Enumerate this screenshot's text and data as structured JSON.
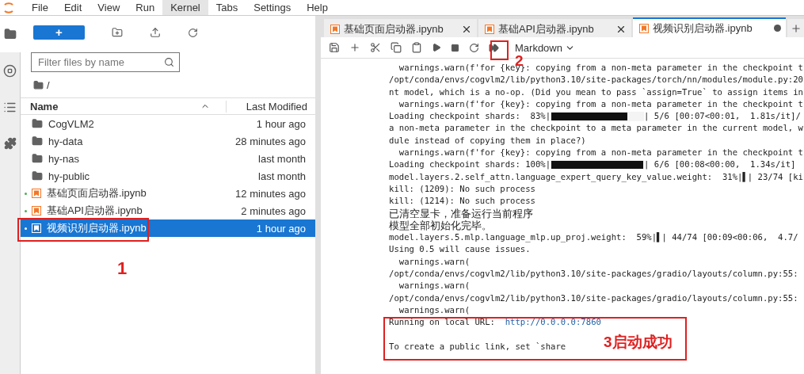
{
  "menu": [
    {
      "label": "File",
      "selected": false
    },
    {
      "label": "Edit",
      "selected": false
    },
    {
      "label": "View",
      "selected": false
    },
    {
      "label": "Run",
      "selected": false
    },
    {
      "label": "Kernel",
      "selected": true
    },
    {
      "label": "Tabs",
      "selected": false
    },
    {
      "label": "Settings",
      "selected": false
    },
    {
      "label": "Help",
      "selected": false
    }
  ],
  "sidebar": {
    "items": [
      {
        "kind": "folder",
        "selected": true
      },
      {
        "kind": "running",
        "selected": false
      },
      {
        "kind": "toc",
        "selected": false
      },
      {
        "kind": "extensions",
        "selected": false
      }
    ]
  },
  "file_browser": {
    "new_button": "+",
    "filter": {
      "placeholder": "Filter files by name"
    },
    "path": "/",
    "columns": [
      "Name",
      "Last Modified"
    ],
    "rows": [
      {
        "kind": "folder",
        "name": "CogVLM2",
        "modified": "1 hour ago",
        "running": false,
        "selected": false
      },
      {
        "kind": "folder",
        "name": "hy-data",
        "modified": "28 minutes ago",
        "running": false,
        "selected": false
      },
      {
        "kind": "folder",
        "name": "hy-nas",
        "modified": "last month",
        "running": false,
        "selected": false
      },
      {
        "kind": "folder",
        "name": "hy-public",
        "modified": "last month",
        "running": false,
        "selected": false
      },
      {
        "kind": "notebook",
        "name": "基础页面启动器.ipynb",
        "modified": "12 minutes ago",
        "running": true,
        "selected": false
      },
      {
        "kind": "notebook",
        "name": "基础API启动器.ipynb",
        "modified": "2 minutes ago",
        "running": true,
        "selected": false
      },
      {
        "kind": "notebook",
        "name": "视频识别启动器.ipynb",
        "modified": "1 hour ago",
        "running": true,
        "selected": true
      }
    ]
  },
  "tabs": [
    {
      "label": "基础页面启动器.ipynb",
      "selected": false,
      "dirty": false
    },
    {
      "label": "基础API启动器.ipynb",
      "selected": false,
      "dirty": false
    },
    {
      "label": "视频识别启动器.ipynb",
      "selected": true,
      "dirty": true
    }
  ],
  "cell_type": "Markdown",
  "output": [
    {
      "kind": "text",
      "text": "  warnings.warn(f'for {key}: copying from a non-meta parameter in the checkpoint t"
    },
    {
      "kind": "text",
      "text": "/opt/conda/envs/cogvlm2/lib/python3.10/site-packages/torch/nn/modules/module.py:20"
    },
    {
      "kind": "text",
      "text": "nt model, which is a no-op. (Did you mean to pass `assign=True` to assign items in"
    },
    {
      "kind": "text",
      "text": "  warnings.warn(f'for {key}: copying from a non-meta parameter in the checkpoint t"
    },
    {
      "kind": "progress",
      "prefix": "Loading checkpoint shards:  83%|",
      "level": 0.83,
      "suffix": "| 5/6 [00:07<00:01,  1.81s/it]/"
    },
    {
      "kind": "text",
      "text": "a non-meta parameter in the checkpoint to a meta parameter in the current model, w"
    },
    {
      "kind": "text",
      "text": "dule instead of copying them in place?)"
    },
    {
      "kind": "text",
      "text": "  warnings.warn(f'for {key}: copying from a non-meta parameter in the checkpoint t"
    },
    {
      "kind": "progress",
      "prefix": "Loading checkpoint shards: 100%|",
      "level": 1,
      "suffix": "| 6/6 [00:08<00:00,  1.34s/it]"
    },
    {
      "kind": "text",
      "text": "model.layers.2.self_attn.language_expert_query_key_value.weight:  31%|▌| 23/74 [ki"
    },
    {
      "kind": "text",
      "text": "kill: (1209): No such process"
    },
    {
      "kind": "text",
      "text": "kill: (1214): No such process"
    },
    {
      "kind": "zh",
      "text": "已清空显卡，准备运行当前程序"
    },
    {
      "kind": "zh",
      "text": "模型全部初始化完毕。"
    },
    {
      "kind": "text",
      "text": "model.layers.5.mlp.language_mlp.up_proj.weight:  59%|▌| 44/74 [00:09<00:06,  4.7/"
    },
    {
      "kind": "text",
      "text": "Using 0.5 will cause issues."
    },
    {
      "kind": "text",
      "text": "  warnings.warn("
    },
    {
      "kind": "text",
      "text": "/opt/conda/envs/cogvlm2/lib/python3.10/site-packages/gradio/layouts/column.py:55:"
    },
    {
      "kind": "text",
      "text": "  warnings.warn("
    },
    {
      "kind": "text",
      "text": "/opt/conda/envs/cogvlm2/lib/python3.10/site-packages/gradio/layouts/column.py:55:"
    },
    {
      "kind": "text",
      "text": "  warnings.warn("
    },
    {
      "kind": "link",
      "prefix": "Running on local URL:  ",
      "link": "http://0.0.0.0:7860"
    },
    {
      "kind": "blank"
    },
    {
      "kind": "text",
      "text": "To create a public link, set `share"
    }
  ],
  "annotations": [
    {
      "kind": "file",
      "label": "1"
    },
    {
      "kind": "toolbar",
      "label": "2"
    },
    {
      "kind": "output",
      "label": "3启动成功"
    }
  ]
}
